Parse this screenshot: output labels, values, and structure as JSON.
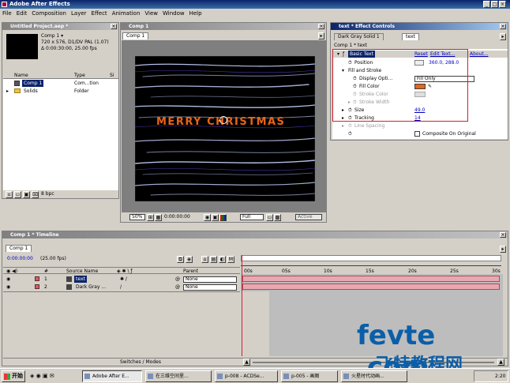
{
  "app": {
    "title": "Adobe After Effects"
  },
  "menu": [
    "File",
    "Edit",
    "Composition",
    "Layer",
    "Effect",
    "Animation",
    "View",
    "Window",
    "Help"
  ],
  "project": {
    "title": "Untitled Project.aep *",
    "comp_name": "Comp 1 ▾",
    "info1": "720 x 576, D1/DV PAL (1.07)",
    "info2": "Δ 0:00:30:00, 25.00 fps",
    "columns": [
      "Name",
      "Type",
      "Si"
    ],
    "items": [
      {
        "name": "Comp 1",
        "type": "Com...tion"
      },
      {
        "name": "Solids",
        "type": "Folder"
      }
    ],
    "bpc": "8 bpc"
  },
  "comp_viewer": {
    "title": "Comp 1",
    "tab": "Comp 1",
    "text": "MERRY CHRISTMAS",
    "zoom": "50%",
    "timecode": "0:00:00:00",
    "quality": "Full",
    "camera": "Active"
  },
  "effect_controls": {
    "title": "text * Effect Controls",
    "tabs": [
      "Dark Gray Solid 1",
      "text"
    ],
    "breadcrumb": "Comp 1 * text",
    "effect_name": "Basic Text",
    "reset": "Reset",
    "edit_text": "Edit Text...",
    "about": "About...",
    "params": [
      {
        "label": "Position",
        "value": "360.0, 288.0"
      },
      {
        "label": "Fill and Stroke",
        "value": ""
      },
      {
        "label": "Display Opti...",
        "value": "Fill Only"
      },
      {
        "label": "Fill Color",
        "value": ""
      },
      {
        "label": "Stroke Color",
        "value": ""
      },
      {
        "label": "Stroke Width",
        "value": ""
      },
      {
        "label": "Size",
        "value": "49.0"
      },
      {
        "label": "Tracking",
        "value": "14"
      },
      {
        "label": "Line Spacing",
        "value": ""
      },
      {
        "label": "",
        "value": "Composite On Original"
      }
    ],
    "colors": {
      "fill": "#e8641a",
      "text_orange": "#e86418"
    }
  },
  "timeline": {
    "title": "Comp 1 * Timeline",
    "tab": "Comp 1",
    "timecode": "0:00:00:00",
    "fps": "(25.00 fps)",
    "columns": [
      "#",
      "Source Name",
      "Parent"
    ],
    "layers": [
      {
        "num": "1",
        "name": "text",
        "parent": "None"
      },
      {
        "num": "2",
        "name": "Dark Gray ...",
        "parent": "None"
      }
    ],
    "ticks": [
      "00s",
      "05s",
      "10s",
      "15s",
      "20s",
      "25s",
      "30s"
    ],
    "switches_label": "Switches / Modes"
  },
  "taskbar": {
    "start": "开始",
    "tasks": [
      "Adobe After E...",
      "在三维空间里...",
      "p-008 - ACDSe...",
      "p-005 - 画图",
      "火星时代动画..."
    ],
    "clock": "2:20"
  },
  "watermark": {
    "line1": "fevte .com",
    "line2": "飞特教程网"
  }
}
